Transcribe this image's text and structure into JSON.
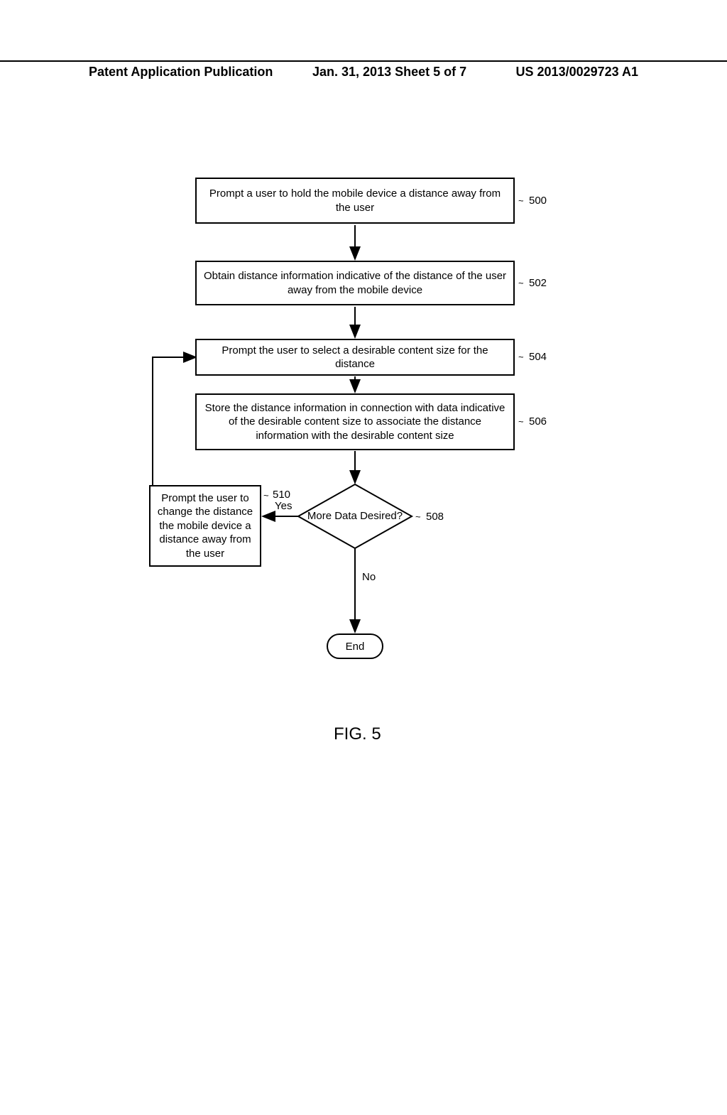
{
  "header": {
    "left": "Patent Application Publication",
    "center": "Jan. 31, 2013  Sheet 5 of 7",
    "right": "US 2013/0029723 A1"
  },
  "boxes": {
    "b500": "Prompt a user to hold the mobile device a distance away from the user",
    "b502": "Obtain distance information indicative of the distance of the user away from the mobile device",
    "b504": "Prompt the user to select a desirable content size for the distance",
    "b506": "Store the distance information in connection with data indicative of the desirable content size to associate the distance information with the desirable content size",
    "b510": "Prompt the user to change the distance the mobile device a distance away from the user"
  },
  "decision": {
    "d508": "More Data Desired?"
  },
  "terminator": {
    "end": "End"
  },
  "refs": {
    "r500": "500",
    "r502": "502",
    "r504": "504",
    "r506": "506",
    "r508": "508",
    "r510": "510"
  },
  "edges": {
    "yes": "Yes",
    "no": "No"
  },
  "caption": "FIG. 5"
}
